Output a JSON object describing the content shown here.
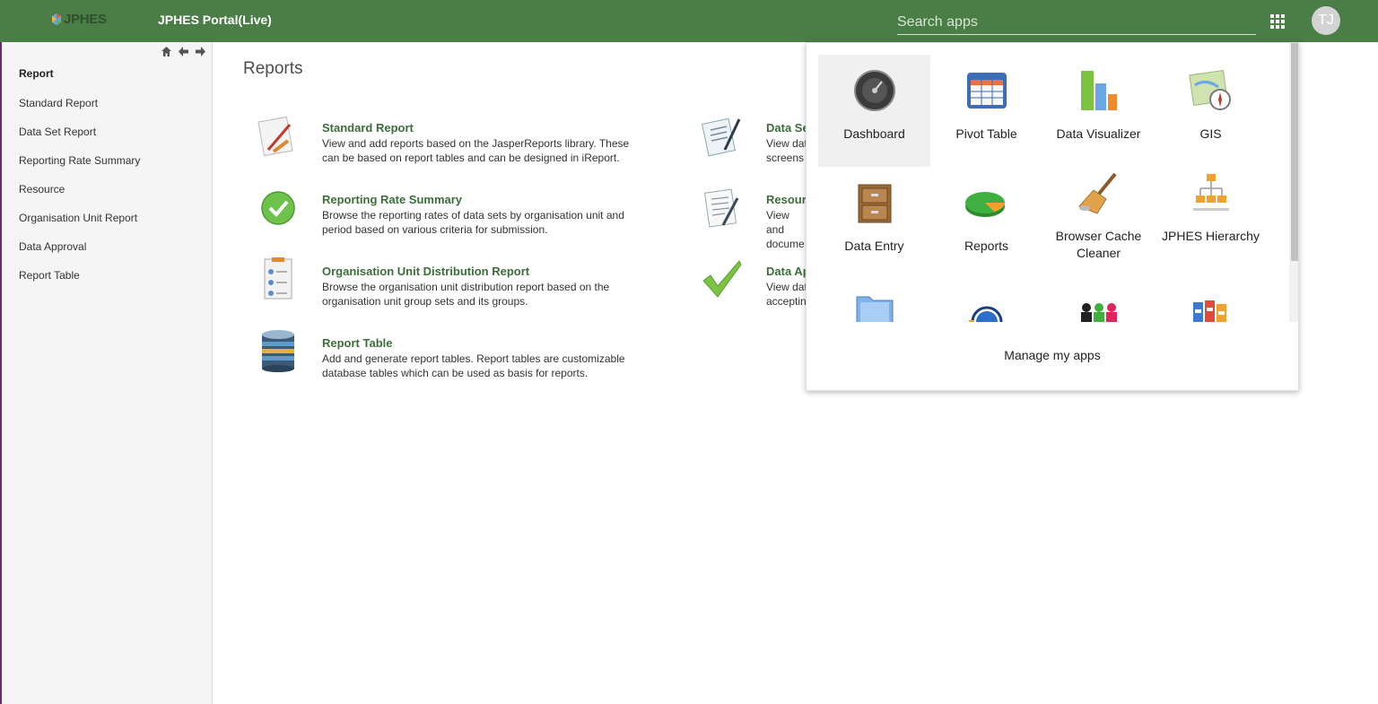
{
  "header": {
    "logo_text": "JPHES",
    "portal_title": "JPHES Portal(Live)",
    "search_placeholder": "Search apps",
    "avatar_initials": "TJ",
    "bg_color": "#4b7d47"
  },
  "sidebar": {
    "heading": "Report",
    "items": [
      {
        "label": "Standard Report"
      },
      {
        "label": "Data Set Report"
      },
      {
        "label": "Reporting Rate Summary"
      },
      {
        "label": "Resource"
      },
      {
        "label": "Organisation Unit Report"
      },
      {
        "label": "Data Approval"
      },
      {
        "label": "Report Table"
      }
    ]
  },
  "main": {
    "title": "Reports",
    "reports": [
      {
        "title": "Standard Report",
        "desc": "View and add reports based on the JasperReports library. These can be based on report tables and can be designed in iReport.",
        "icon": "pencil-ruler-icon"
      },
      {
        "title": "Data Se",
        "desc": "View dat screens",
        "icon": "document-pen-icon"
      },
      {
        "title": "Reporting Rate Summary",
        "desc": "Browse the reporting rates of data sets by organisation unit and period based on various criteria for submission.",
        "icon": "check-circle-icon"
      },
      {
        "title": "Resour",
        "desc": "View and docume",
        "icon": "document-pen-icon"
      },
      {
        "title": "Organisation Unit Distribution Report",
        "desc": "Browse the organisation unit distribution report based on the organisation unit group sets and its groups.",
        "icon": "clipboard-users-icon"
      },
      {
        "title": "Data Ap",
        "desc": "View dat acceptin",
        "icon": "checkmark-icon"
      },
      {
        "title": "Report Table",
        "desc": "Add and generate report tables. Report tables are customizable database tables which can be used as basis for reports.",
        "icon": "database-icon"
      }
    ]
  },
  "apps_menu": {
    "apps": [
      {
        "label": "Dashboard",
        "icon": "dashboard-icon",
        "active": true
      },
      {
        "label": "Pivot Table",
        "icon": "pivot-table-icon"
      },
      {
        "label": "Data Visualizer",
        "icon": "bar-chart-icon"
      },
      {
        "label": "GIS",
        "icon": "map-compass-icon"
      },
      {
        "label": "Data Entry",
        "icon": "file-cabinet-icon"
      },
      {
        "label": "Reports",
        "icon": "pie-chart-icon"
      },
      {
        "label": "Browser Cache Cleaner",
        "icon": "broom-icon"
      },
      {
        "label": "JPHES Hierarchy",
        "icon": "hierarchy-icon"
      },
      {
        "label": "",
        "icon": "folder-icon"
      },
      {
        "label": "",
        "icon": "headset-icon"
      },
      {
        "label": "",
        "icon": "puzzle-people-icon"
      },
      {
        "label": "",
        "icon": "binders-icon"
      }
    ],
    "manage_label": "Manage my apps"
  }
}
